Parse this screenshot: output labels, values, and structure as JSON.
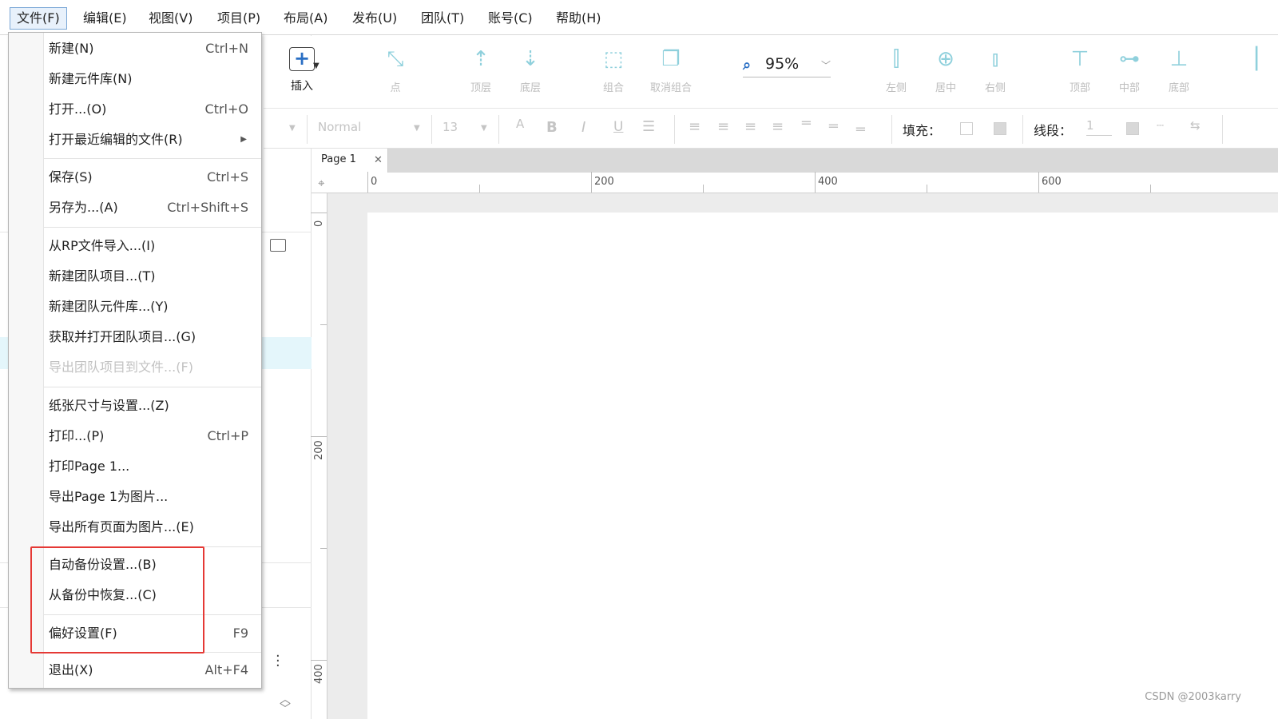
{
  "menubar": {
    "items": [
      "文件(F)",
      "编辑(E)",
      "视图(V)",
      "项目(P)",
      "布局(A)",
      "发布(U)",
      "团队(T)",
      "账号(C)",
      "帮助(H)"
    ]
  },
  "toolbar": {
    "insert_label": "插入",
    "point_label": "点",
    "top_layer_label": "顶层",
    "bottom_layer_label": "底层",
    "group_label": "组合",
    "ungroup_label": "取消组合",
    "zoom_value": "95%",
    "align_left_label": "左侧",
    "align_center_label": "居中",
    "align_right_label": "右侧",
    "align_top_label": "顶部",
    "align_middle_label": "中部",
    "align_bottom_label": "底部"
  },
  "format_bar": {
    "style_value": "Normal",
    "font_size": "13",
    "fill_label": "填充：",
    "line_label": "线段：",
    "line_width": "1"
  },
  "file_menu": {
    "items": [
      {
        "label": "新建(N)",
        "shortcut": "Ctrl+N"
      },
      {
        "label": "新建元件库(N)",
        "shortcut": ""
      },
      {
        "label": "打开...(O)",
        "shortcut": "Ctrl+O"
      },
      {
        "label": "打开最近编辑的文件(R)",
        "shortcut": ""
      },
      {
        "label": "保存(S)",
        "shortcut": "Ctrl+S"
      },
      {
        "label": "另存为...(A)",
        "shortcut": "Ctrl+Shift+S"
      },
      {
        "label": "从RP文件导入...(I)",
        "shortcut": ""
      },
      {
        "label": "新建团队项目...(T)",
        "shortcut": ""
      },
      {
        "label": "新建团队元件库...(Y)",
        "shortcut": ""
      },
      {
        "label": "获取并打开团队项目...(G)",
        "shortcut": ""
      },
      {
        "label": "导出团队项目到文件...(F)",
        "shortcut": ""
      },
      {
        "label": "纸张尺寸与设置...(Z)",
        "shortcut": ""
      },
      {
        "label": "打印...(P)",
        "shortcut": "Ctrl+P"
      },
      {
        "label": "打印Page 1...",
        "shortcut": ""
      },
      {
        "label": "导出Page 1为图片...",
        "shortcut": ""
      },
      {
        "label": "导出所有页面为图片...(E)",
        "shortcut": ""
      },
      {
        "label": "自动备份设置...(B)",
        "shortcut": ""
      },
      {
        "label": "从备份中恢复...(C)",
        "shortcut": ""
      },
      {
        "label": "偏好设置(F)",
        "shortcut": "F9"
      },
      {
        "label": "退出(X)",
        "shortcut": "Alt+F4"
      }
    ]
  },
  "tabs": {
    "page1": "Page 1"
  },
  "ruler": {
    "h": [
      "0",
      "200",
      "400",
      "600"
    ],
    "v": [
      "0",
      "200",
      "400"
    ]
  },
  "watermark": "CSDN @2003karry",
  "colors": {
    "accent": "#2a6fc4",
    "icon_tint": "#8fd0dc",
    "highlight_border": "#e53935",
    "selection_bg": "#e4f6fb"
  }
}
